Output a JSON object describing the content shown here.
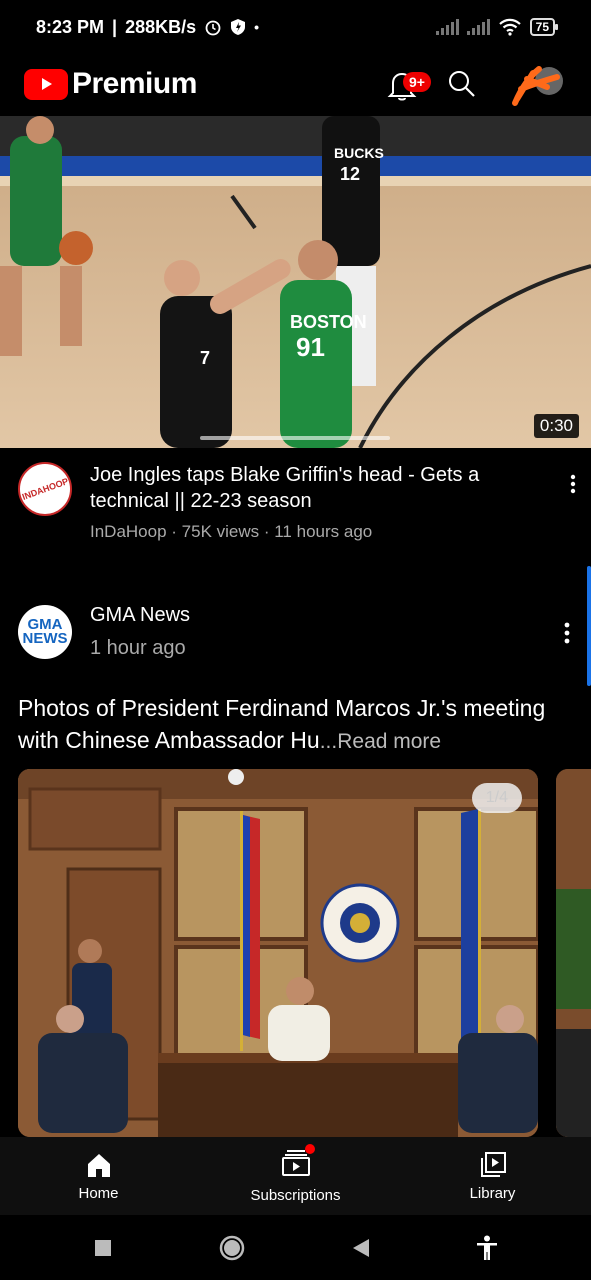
{
  "status_bar": {
    "time": "8:23 PM",
    "speed": "288KB/s",
    "battery": "75"
  },
  "header": {
    "brand": "Premium",
    "notification_count": "9+"
  },
  "video": {
    "duration": "0:30",
    "title": "Joe Ingles taps Blake Griffin's head - Gets a technical || 22-23 season",
    "meta": "InDaHoop · 75K views · 11 hours ago",
    "channel_avatar_text": "INDAHOOP"
  },
  "post": {
    "channel": "GMA News",
    "time": "1 hour ago",
    "text": "Photos of President Ferdinand Marcos Jr.'s meeting with Chinese Ambassador Hu",
    "read_more": "...Read more",
    "image_counter": "1/4",
    "avatar_line1": "GMA",
    "avatar_line2": "NEWS"
  },
  "bottom_nav": {
    "items": [
      {
        "label": "Home",
        "icon": "home-icon"
      },
      {
        "label": "Subscriptions",
        "icon": "subscriptions-icon"
      },
      {
        "label": "Library",
        "icon": "library-icon"
      }
    ]
  },
  "colors": {
    "brand_red": "#ff0000",
    "background": "#000000",
    "secondary_text": "#aaaaaa",
    "accent_blue": "#1a73e8"
  }
}
